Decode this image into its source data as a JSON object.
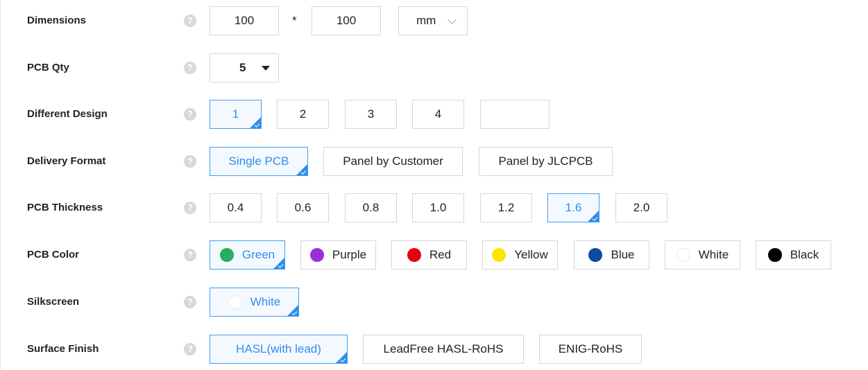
{
  "dimensions": {
    "label": "Dimensions",
    "width": "100",
    "separator": "*",
    "height": "100",
    "unit": "mm"
  },
  "pcb_qty": {
    "label": "PCB Qty",
    "value": "5"
  },
  "different_design": {
    "label": "Different Design",
    "options": [
      "1",
      "2",
      "3",
      "4",
      ""
    ],
    "selected": "1"
  },
  "delivery_format": {
    "label": "Delivery Format",
    "options": [
      "Single PCB",
      "Panel by Customer",
      "Panel by JLCPCB"
    ],
    "selected": "Single PCB"
  },
  "pcb_thickness": {
    "label": "PCB Thickness",
    "options": [
      "0.4",
      "0.6",
      "0.8",
      "1.0",
      "1.2",
      "1.6",
      "2.0"
    ],
    "selected": "1.6"
  },
  "pcb_color": {
    "label": "PCB Color",
    "selected": "Green",
    "options": [
      {
        "name": "Green",
        "color": "#27ae60"
      },
      {
        "name": "Purple",
        "color": "#9b30d9"
      },
      {
        "name": "Red",
        "color": "#e60012"
      },
      {
        "name": "Yellow",
        "color": "#ffe600"
      },
      {
        "name": "Blue",
        "color": "#0a4ba0"
      },
      {
        "name": "White",
        "color": "#ffffff"
      },
      {
        "name": "Black",
        "color": "#000000"
      }
    ]
  },
  "silkscreen": {
    "label": "Silkscreen",
    "options": [
      {
        "name": "White",
        "color": "#ffffff"
      }
    ],
    "selected": "White"
  },
  "surface_finish": {
    "label": "Surface Finish",
    "options": [
      "HASL(with lead)",
      "LeadFree HASL-RoHS",
      "ENIG-RoHS"
    ],
    "selected": "HASL(with lead)"
  },
  "help_icon_glyph": "?",
  "colors": {
    "accent": "#2f8ee8",
    "selected_bg": "#f4f9ff",
    "border": "#d6d6d6"
  }
}
